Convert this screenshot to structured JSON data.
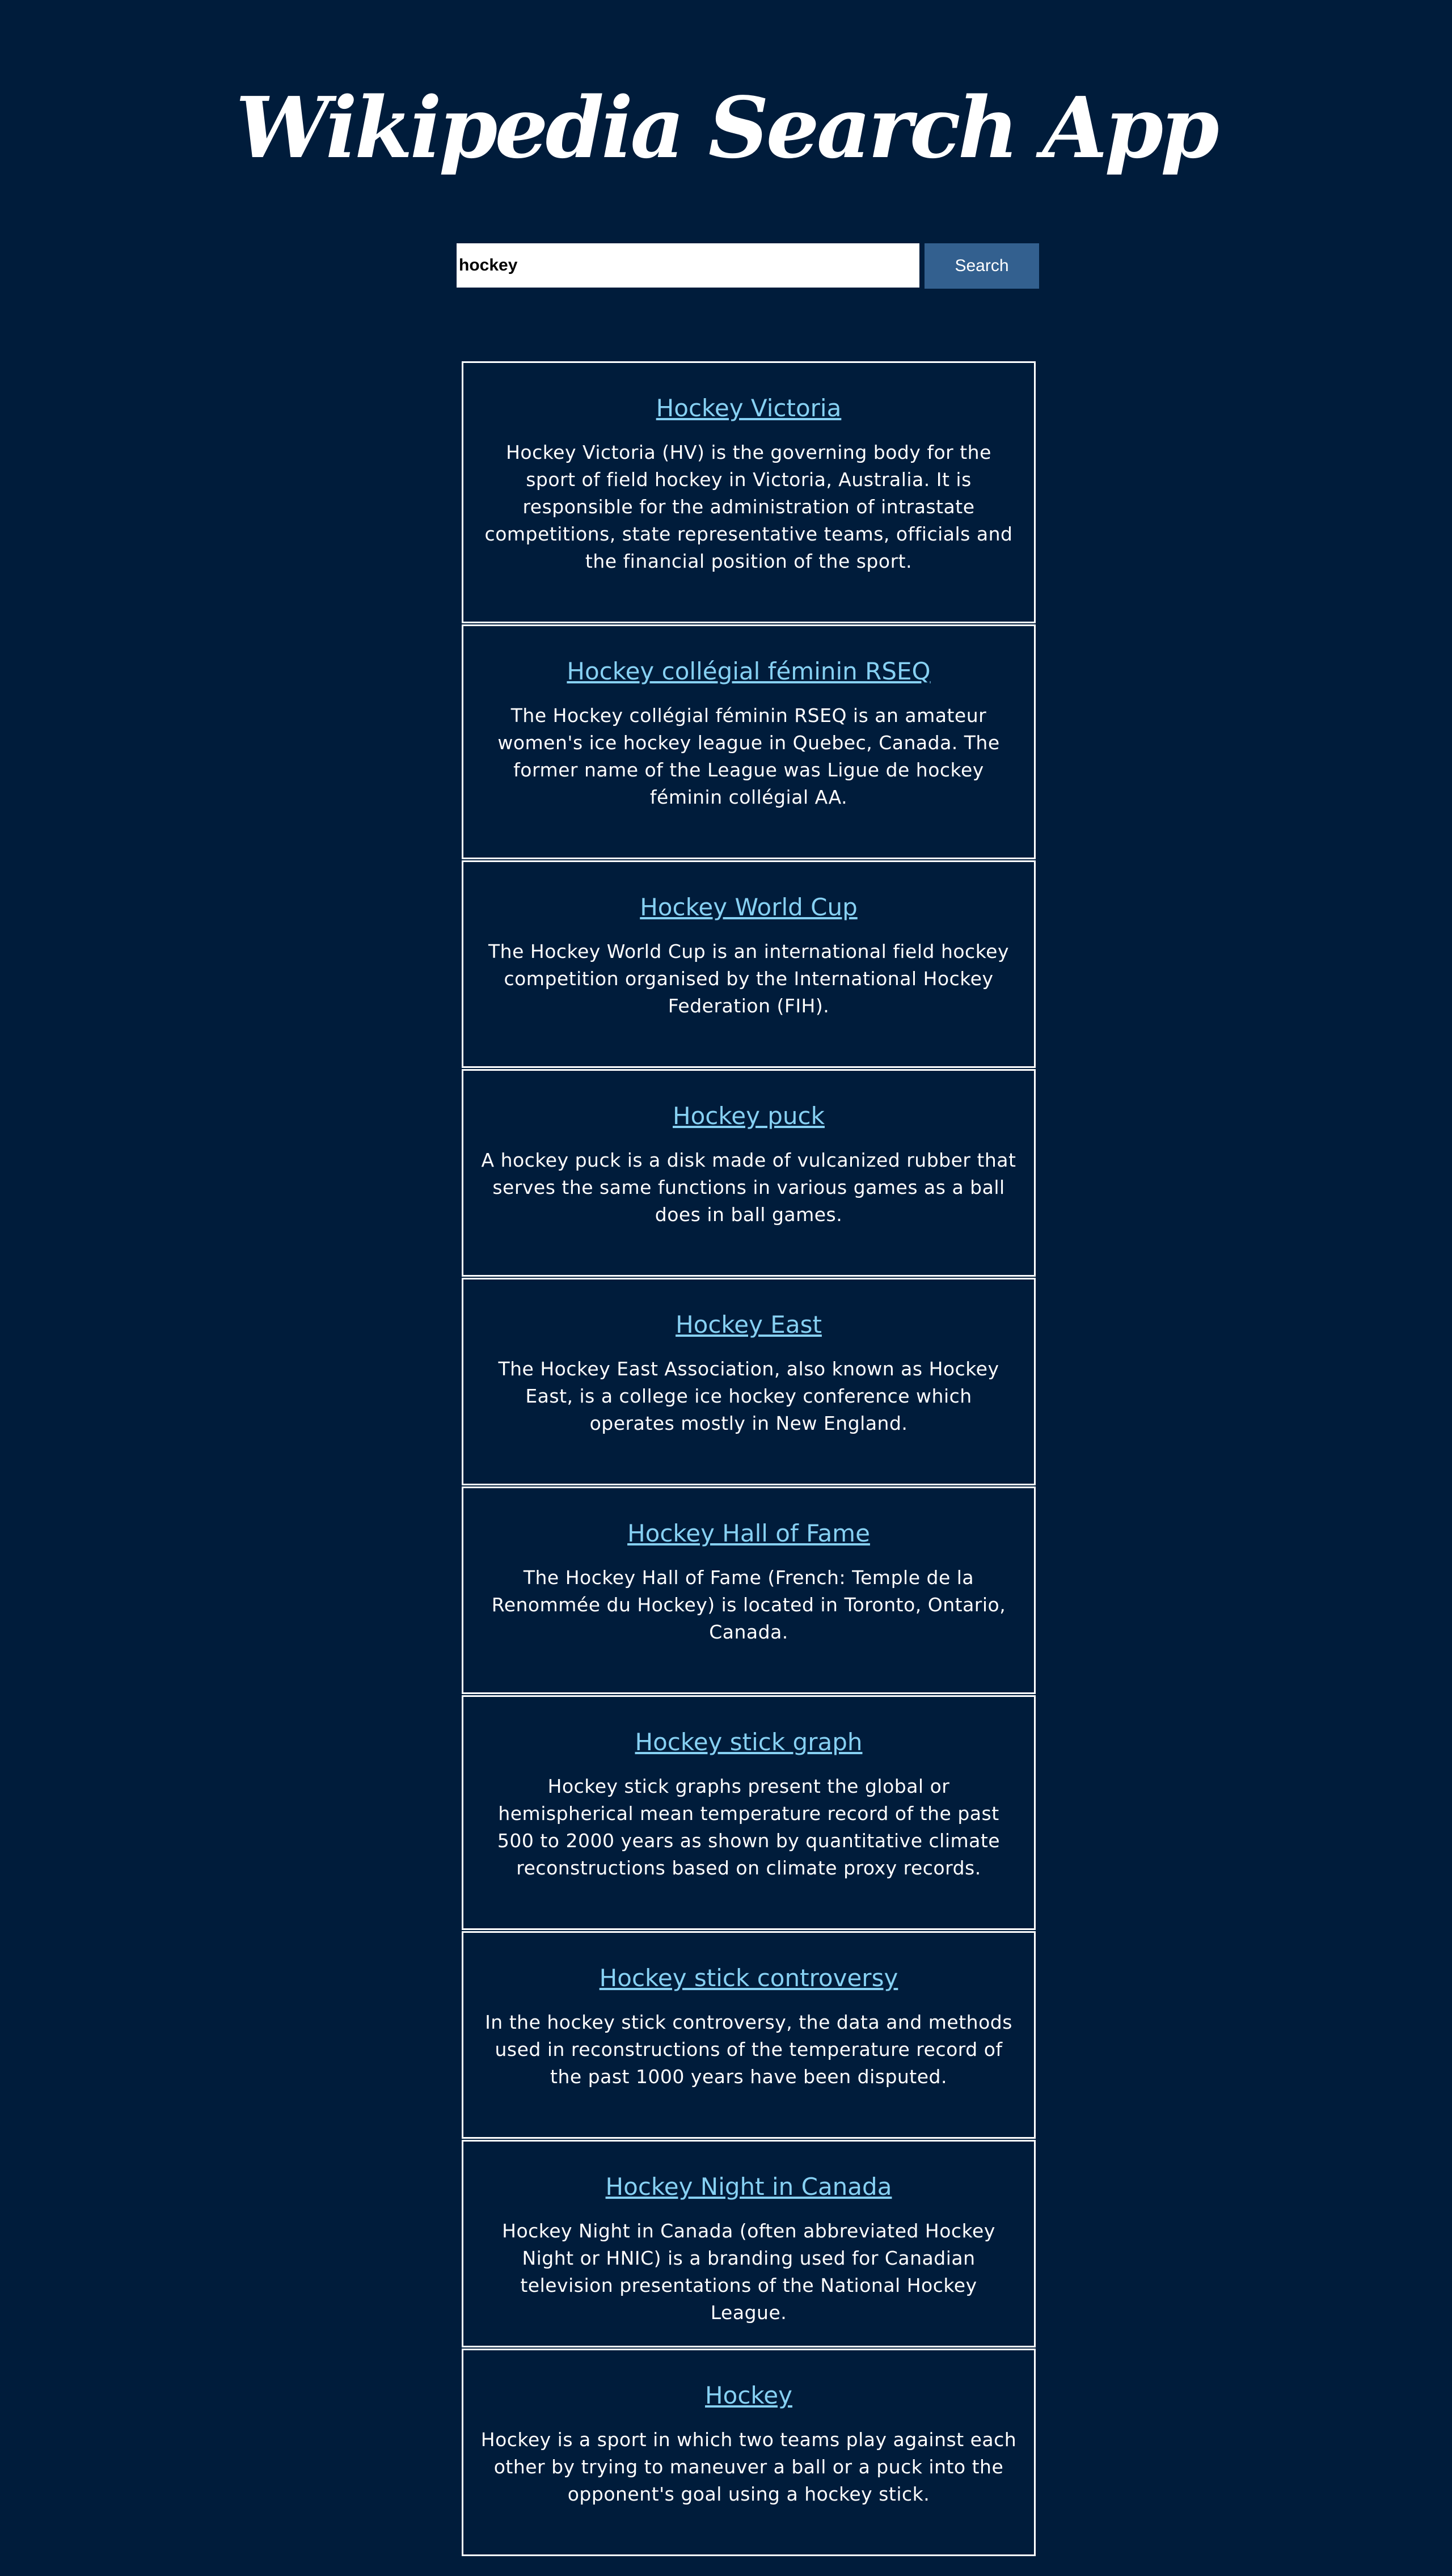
{
  "header": {
    "title": "Wikipedia Search App"
  },
  "search": {
    "value": "hockey",
    "button_label": "Search"
  },
  "colors": {
    "background": "#001c3b",
    "link": "#87d1f3",
    "button": "#33608f",
    "text": "#ffffff"
  },
  "results": [
    {
      "title": "Hockey Victoria",
      "snippet": "Hockey Victoria (HV) is the governing body for the sport of field hockey in Victoria, Australia. It is responsible for the administration of intrastate competitions, state representative teams, officials and the financial position of the sport."
    },
    {
      "title": "Hockey collégial féminin RSEQ",
      "snippet": "The Hockey collégial féminin RSEQ is an amateur women's ice hockey league in Quebec, Canada. The former name of the League was Ligue de hockey féminin collégial AA."
    },
    {
      "title": "Hockey World Cup",
      "snippet": "The Hockey World Cup is an international field hockey competition organised by the International Hockey Federation (FIH)."
    },
    {
      "title": "Hockey puck",
      "snippet": "A hockey puck is a disk made of vulcanized rubber that serves the same functions in various games as a ball does in ball games."
    },
    {
      "title": "Hockey East",
      "snippet": "The Hockey East Association, also known as Hockey East, is a college ice hockey conference which operates mostly in New England."
    },
    {
      "title": "Hockey Hall of Fame",
      "snippet": "The Hockey Hall of Fame (French: Temple de la Renommée du Hockey) is located in Toronto, Ontario, Canada."
    },
    {
      "title": "Hockey stick graph",
      "snippet": "Hockey stick graphs present the global or hemispherical mean temperature record of the past 500 to 2000 years as shown by quantitative climate reconstructions based on climate proxy records."
    },
    {
      "title": "Hockey stick controversy",
      "snippet": "In the hockey stick controversy, the data and methods used in reconstructions of the temperature record of the past 1000 years have been disputed."
    },
    {
      "title": "Hockey Night in Canada",
      "snippet": "Hockey Night in Canada (often abbreviated Hockey Night or HNIC) is a branding used for Canadian television presentations of the National Hockey League."
    },
    {
      "title": "Hockey",
      "snippet": "Hockey is a sport in which two teams play against each other by trying to maneuver a ball or a puck into the opponent's goal using a hockey stick."
    }
  ]
}
